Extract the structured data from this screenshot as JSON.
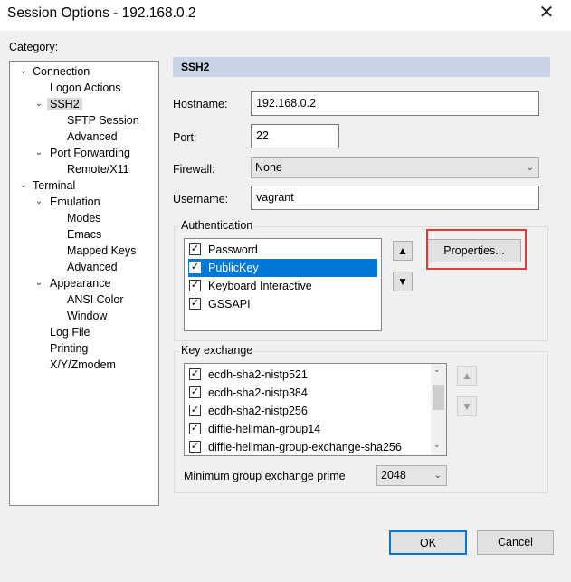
{
  "window": {
    "title": "Session Options - 192.168.0.2"
  },
  "category_label": "Category:",
  "tree": [
    {
      "label": "Connection",
      "level": 0,
      "expander": "⌄"
    },
    {
      "label": "Logon Actions",
      "level": 1,
      "expander": ""
    },
    {
      "label": "SSH2",
      "level": 1,
      "expander": "⌄",
      "selected": true
    },
    {
      "label": "SFTP Session",
      "level": 2,
      "expander": ""
    },
    {
      "label": "Advanced",
      "level": 2,
      "expander": ""
    },
    {
      "label": "Port Forwarding",
      "level": 1,
      "expander": "⌄"
    },
    {
      "label": "Remote/X11",
      "level": 2,
      "expander": ""
    },
    {
      "label": "Terminal",
      "level": 0,
      "expander": "⌄"
    },
    {
      "label": "Emulation",
      "level": 1,
      "expander": "⌄"
    },
    {
      "label": "Modes",
      "level": 2,
      "expander": ""
    },
    {
      "label": "Emacs",
      "level": 2,
      "expander": ""
    },
    {
      "label": "Mapped Keys",
      "level": 2,
      "expander": ""
    },
    {
      "label": "Advanced",
      "level": 2,
      "expander": ""
    },
    {
      "label": "Appearance",
      "level": 1,
      "expander": "⌄"
    },
    {
      "label": "ANSI Color",
      "level": 2,
      "expander": ""
    },
    {
      "label": "Window",
      "level": 2,
      "expander": ""
    },
    {
      "label": "Log File",
      "level": 1,
      "expander": ""
    },
    {
      "label": "Printing",
      "level": 1,
      "expander": ""
    },
    {
      "label": "X/Y/Zmodem",
      "level": 1,
      "expander": ""
    }
  ],
  "panel": {
    "header": "SSH2",
    "hostname_label": "Hostname:",
    "hostname": "192.168.0.2",
    "port_label": "Port:",
    "port": "22",
    "firewall_label": "Firewall:",
    "firewall": "None",
    "username_label": "Username:",
    "username": "vagrant",
    "auth_label": "Authentication",
    "auth_items": [
      {
        "label": "Password",
        "checked": true
      },
      {
        "label": "PublicKey",
        "checked": true,
        "highlighted": true
      },
      {
        "label": "Keyboard Interactive",
        "checked": true
      },
      {
        "label": "GSSAPI",
        "checked": true
      }
    ],
    "properties_label": "Properties...",
    "kex_label": "Key exchange",
    "kex_items": [
      {
        "label": "ecdh-sha2-nistp521",
        "checked": true
      },
      {
        "label": "ecdh-sha2-nistp384",
        "checked": true
      },
      {
        "label": "ecdh-sha2-nistp256",
        "checked": true
      },
      {
        "label": "diffie-hellman-group14",
        "checked": true
      },
      {
        "label": "diffie-hellman-group-exchange-sha256",
        "checked": true
      }
    ],
    "min_prime_label": "Minimum group exchange prime",
    "min_prime": "2048"
  },
  "buttons": {
    "ok": "OK",
    "cancel": "Cancel"
  },
  "colors": {
    "highlight": "#0078d7",
    "header": "#c8d4e4",
    "callout": "#e53935"
  },
  "icons": {
    "close": "✕",
    "check": "✓",
    "up": "▲",
    "down": "▼",
    "chevron": "⌄"
  }
}
